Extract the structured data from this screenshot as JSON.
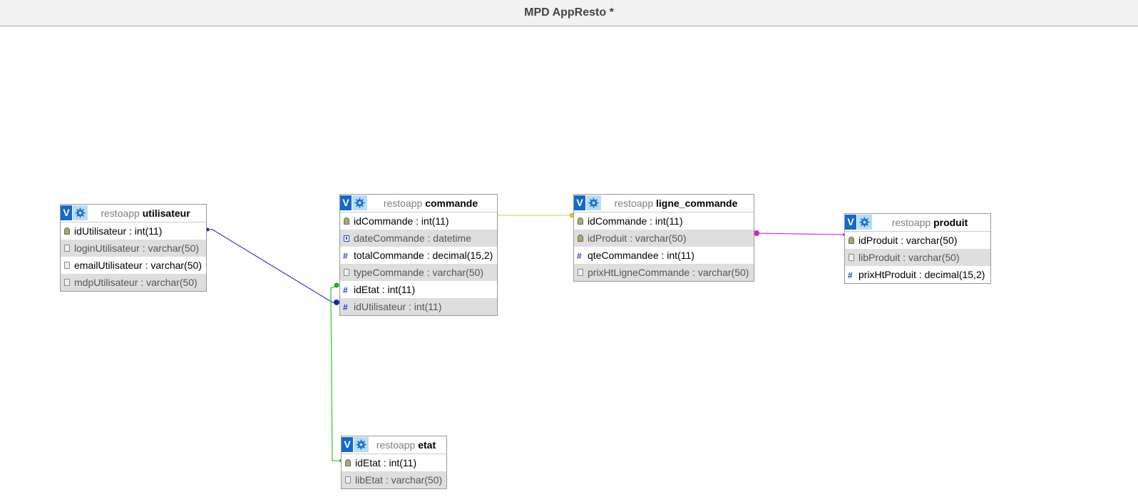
{
  "window": {
    "title": "MPD AppResto *"
  },
  "tables": {
    "utilisateur": {
      "database": "restoapp",
      "name": "utilisateur",
      "columns": [
        {
          "label": "idUtilisateur : int(11)",
          "icon": "key-icon"
        },
        {
          "label": "loginUtilisateur : varchar(50)",
          "icon": "text-field-icon"
        },
        {
          "label": "emailUtilisateur : varchar(50)",
          "icon": "text-field-icon"
        },
        {
          "label": "mdpUtilisateur : varchar(50)",
          "icon": "text-field-icon"
        }
      ]
    },
    "commande": {
      "database": "restoapp",
      "name": "commande",
      "columns": [
        {
          "label": "idCommande : int(11)",
          "icon": "key-icon"
        },
        {
          "label": "dateCommande : datetime",
          "icon": "date-icon"
        },
        {
          "label": "totalCommande : decimal(15,2)",
          "icon": "number-icon"
        },
        {
          "label": "typeCommande : varchar(50)",
          "icon": "text-field-icon"
        },
        {
          "label": "idEtat : int(11)",
          "icon": "number-icon"
        },
        {
          "label": "idUtilisateur : int(11)",
          "icon": "number-icon"
        }
      ]
    },
    "ligne_commande": {
      "database": "restoapp",
      "name": "ligne_commande",
      "columns": [
        {
          "label": "idCommande : int(11)",
          "icon": "key-icon"
        },
        {
          "label": "idProduit : varchar(50)",
          "icon": "key-icon"
        },
        {
          "label": "qteCommandee : int(11)",
          "icon": "number-icon"
        },
        {
          "label": "prixHtLigneCommande : varchar(50)",
          "icon": "text-field-icon"
        }
      ]
    },
    "produit": {
      "database": "restoapp",
      "name": "produit",
      "columns": [
        {
          "label": "idProduit : varchar(50)",
          "icon": "key-icon"
        },
        {
          "label": "libProduit : varchar(50)",
          "icon": "text-field-icon"
        },
        {
          "label": "prixHtProduit : decimal(15,2)",
          "icon": "number-icon"
        }
      ]
    },
    "etat": {
      "database": "restoapp",
      "name": "etat",
      "columns": [
        {
          "label": "idEtat : int(11)",
          "icon": "key-icon"
        },
        {
          "label": "libEtat : varchar(50)",
          "icon": "text-field-icon"
        }
      ]
    }
  },
  "buttons": {
    "view_label": "V"
  },
  "colors": {
    "rel_utilisateur_commande": "#3b48d8",
    "rel_etat_commande": "#33cc33",
    "rel_commande_ligne": "#dddd55",
    "rel_produit_ligne": "#dd33dd"
  }
}
